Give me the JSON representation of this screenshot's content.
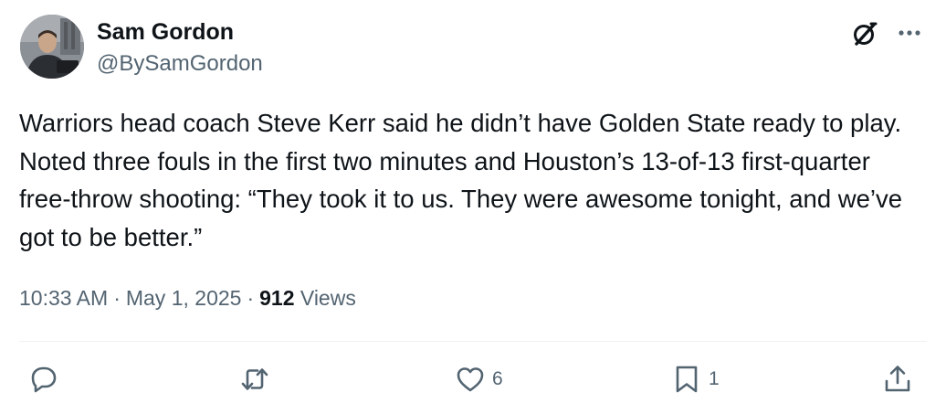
{
  "author": {
    "name": "Sam Gordon",
    "handle": "@BySamGordon"
  },
  "tweet": {
    "text": "Warriors head coach Steve Kerr said he didn’t have Golden State ready to play. Noted three fouls in the first two minutes and Houston’s 13-of-13 first-quarter free-throw shooting: “They took it to us. They were awesome tonight, and we’ve got to be better.”"
  },
  "meta": {
    "time": "10:33 AM",
    "separator": "·",
    "date": "May 1, 2025",
    "views_count": "912",
    "views_label": "Views"
  },
  "actions": {
    "reply_count": "",
    "retweet_count": "",
    "like_count": "6",
    "bookmark_count": "1"
  },
  "icons": [
    "grok-icon",
    "more-icon",
    "reply-icon",
    "retweet-icon",
    "like-icon",
    "bookmark-icon",
    "share-icon"
  ],
  "colors": {
    "text_primary": "#0f1419",
    "text_secondary": "#536471",
    "divider": "#eff3f4"
  }
}
